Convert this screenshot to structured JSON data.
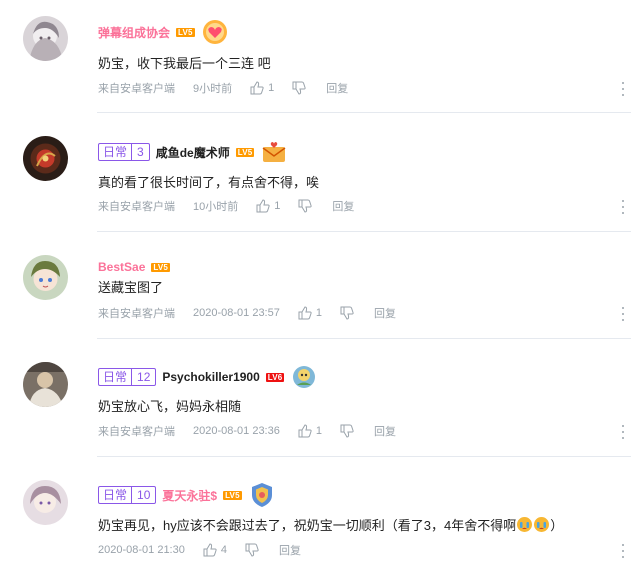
{
  "comments": [
    {
      "username": "弹幕组成协会",
      "level": "LV5",
      "fan_badge": null,
      "text": "奶宝，收下我最后一个三连 吧",
      "source": "来自安卓客户端",
      "time": "9小时前",
      "likes": "1",
      "reply_label": "回复",
      "avatar_icon": "avatar-anime-girl-icon",
      "pendant_icon": "heart-badge-icon"
    },
    {
      "username": "咸鱼de魔术师",
      "level": "LV5",
      "fan_badge": {
        "name": "日常",
        "level": "3"
      },
      "text": "真的看了很长时间了，有点舍不得，唉",
      "source": "来自安卓客户端",
      "time": "10小时前",
      "likes": "1",
      "reply_label": "回复",
      "avatar_icon": "avatar-dark-emblem-icon",
      "pendant_icon": "letter-envelope-icon"
    },
    {
      "username": "BestSae",
      "level": "LV5",
      "fan_badge": null,
      "text": "送藏宝图了",
      "source": "来自安卓客户端",
      "time": "2020-08-01 23:57",
      "likes": "1",
      "reply_label": "回复",
      "avatar_icon": "avatar-anime-character-icon",
      "pendant_icon": null
    },
    {
      "username": "Psychokiller1900",
      "level": "LV6",
      "fan_badge": {
        "name": "日常",
        "level": "12"
      },
      "text": "奶宝放心飞，妈妈永相随",
      "source": "来自安卓客户端",
      "time": "2020-08-01 23:36",
      "likes": "1",
      "reply_label": "回复",
      "avatar_icon": "avatar-photo-icon",
      "pendant_icon": "robot-badge-icon"
    },
    {
      "username": "夏天永驻$",
      "level": "LV5",
      "fan_badge": {
        "name": "日常",
        "level": "10"
      },
      "text_before": "奶宝再见，hy应该不会跟过去了，祝奶宝一切顺利（看了3，4年舍不得啊",
      "text_after": "）",
      "source": "",
      "time": "2020-08-01 21:30",
      "likes": "4",
      "reply_label": "回复",
      "avatar_icon": "avatar-anime-girl-icon",
      "pendant_icon": "shield-badge-icon",
      "emotes": [
        "crying-emote-icon",
        "crying-emote-icon"
      ]
    }
  ],
  "colors": {
    "username_pink": "#fb7299",
    "fan_badge_purple": "#8a57e8",
    "meta_gray": "#99a2aa",
    "level_orange": "#ff9a00",
    "level_red": "#ee1111"
  }
}
